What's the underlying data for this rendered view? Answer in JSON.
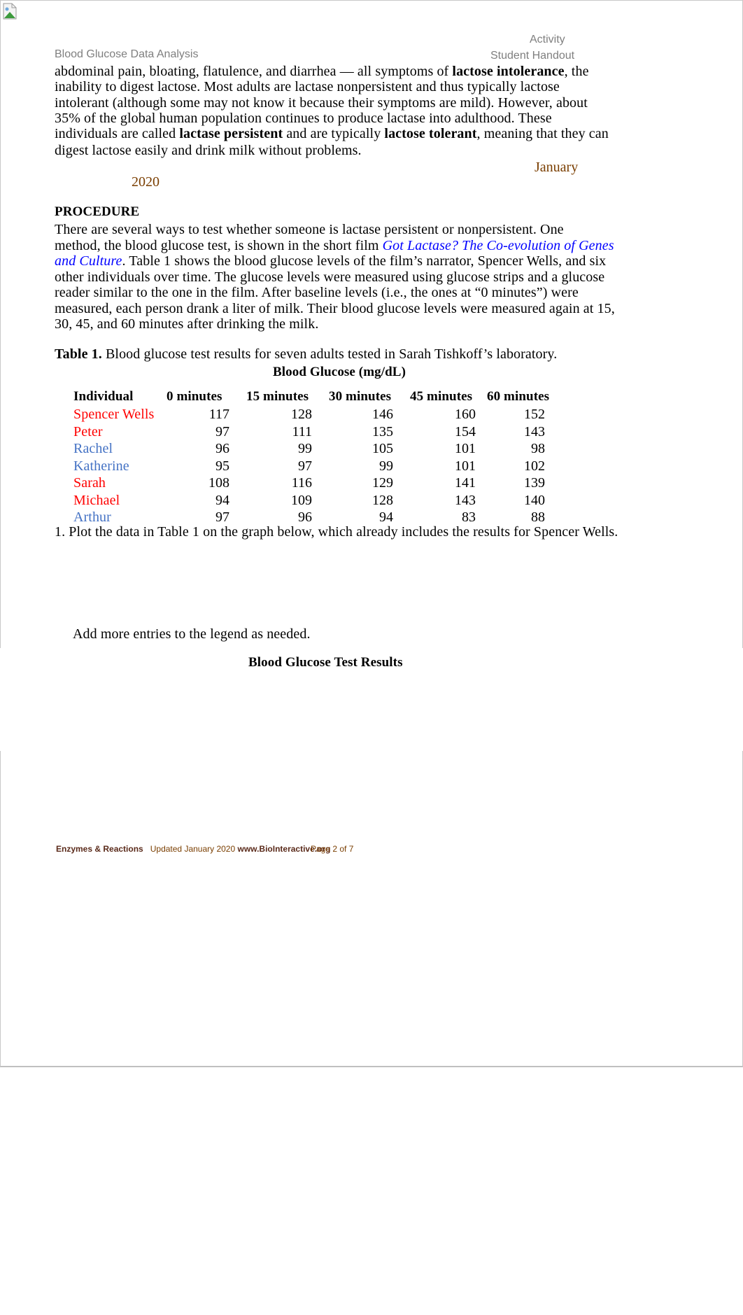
{
  "header": {
    "left": "Blood Glucose Data Analysis",
    "right_top": "Activity",
    "right_bottom": "Student Handout"
  },
  "intro": {
    "l1a": "abdominal pain, bloating, flatulence, and diarrhea — all symptoms of ",
    "l1b": "lactose intolerance",
    ", l1c": "",
    "l1c2": ", the",
    "l2": "inability to digest lactose. Most adults are lactase nonpersistent and thus typically lactose",
    "l3": "intolerant (although some may not know it because their symptoms are mild). However, about",
    "l4": "35% of the global human population continues to produce lactase into adulthood. These",
    "l5a": "individuals are called ",
    "l5b": "lactase persistent",
    "l5c": " and are typically ",
    "l5d": "lactose tolerant",
    "l5e": ", meaning that they can",
    "l6": "digest lactose easily and drink milk without problems."
  },
  "date": {
    "month": "January",
    "year": "2020"
  },
  "procedure": {
    "heading": "PROCEDURE",
    "l1": "There are several ways to test whether someone is lactase persistent or nonpersistent. One",
    "l2a": "method, the blood glucose test, is shown in the short film ",
    "l2b": "Got Lactase? The Co-evolution of Genes",
    "l3a": "and Culture",
    "l3b": ". Table 1 shows the blood glucose levels of the film’s narrator, Spencer Wells, and six",
    "l4": "other individuals over time. The glucose levels were measured using glucose strips and a glucose",
    "l5": "reader similar to the one in the film. After baseline levels (i.e., the ones at “0 minutes”) were",
    "l6": "measured, each person drank a liter of milk. Their blood glucose levels were measured again at 15,",
    "l7": "30, 45, and 60 minutes after drinking the milk."
  },
  "table": {
    "caption_bold": "Table 1.",
    "caption": " Blood glucose test results for seven adults tested in Sarah Tishkoff’s laboratory.",
    "group_header": "Blood Glucose (mg/dL)",
    "columns": [
      "Individual",
      "0 minutes",
      "15 minutes",
      "30 minutes",
      "45 minutes",
      "60 minutes"
    ],
    "colors": {
      "red": "#ff0000",
      "blue": "#4472c4"
    },
    "rows": [
      {
        "name": "Spencer Wells",
        "color": "red",
        "values": [
          "117",
          "128",
          "146",
          "160",
          "152"
        ]
      },
      {
        "name": "Peter",
        "color": "red",
        "values": [
          "97",
          "111",
          "135",
          "154",
          "143"
        ]
      },
      {
        "name": "Rachel",
        "color": "blue",
        "values": [
          "96",
          "99",
          "105",
          "101",
          "98"
        ]
      },
      {
        "name": "Katherine",
        "color": "blue",
        "values": [
          "95",
          "97",
          "99",
          "101",
          "102"
        ]
      },
      {
        "name": "Sarah",
        "color": "red",
        "values": [
          "108",
          "116",
          "129",
          "141",
          "139"
        ]
      },
      {
        "name": "Michael",
        "color": "red",
        "values": [
          "94",
          "109",
          "128",
          "143",
          "140"
        ]
      },
      {
        "name": "Arthur",
        "color": "blue",
        "values": [
          "97",
          "96",
          "94",
          "83",
          "88"
        ]
      }
    ]
  },
  "question1": "1. Plot the data in Table 1 on the graph below, which already includes the results for Spencer Wells.",
  "legend_note": "Add more entries to the legend as needed.",
  "graph_title": "Blood Glucose Test Results",
  "footer": {
    "unit": "Enzymes & Reactions",
    "updated": "Updated January 2020",
    "site": "www.BioInteractive.org",
    "page": "Page 2 of 7"
  }
}
